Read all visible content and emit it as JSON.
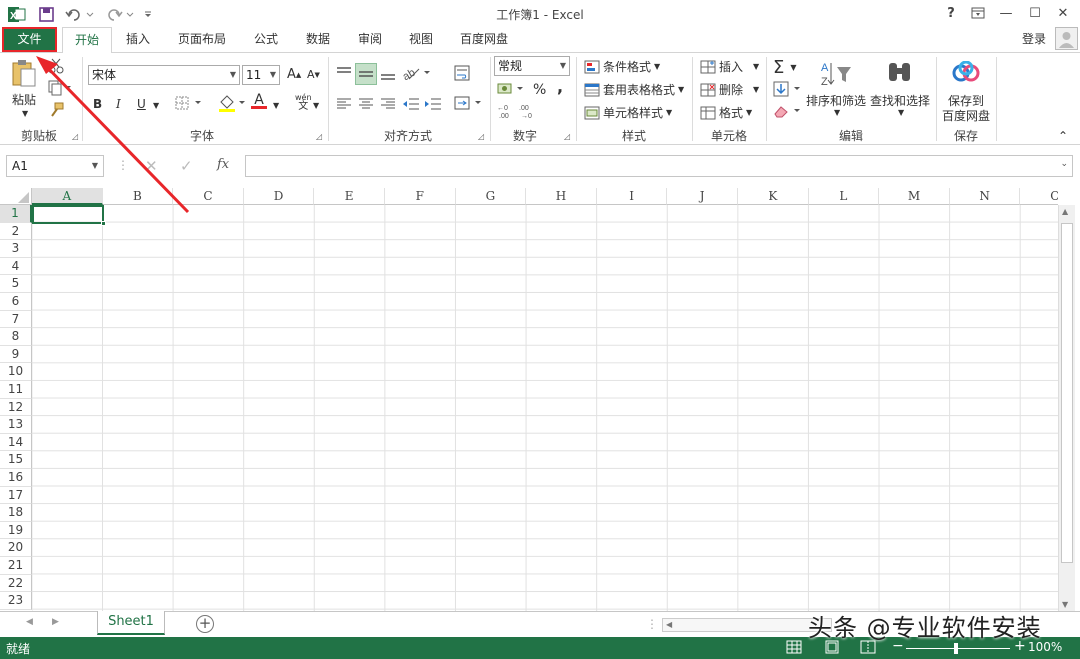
{
  "titlebar": {
    "title": "工作簿1 - Excel",
    "help": "?",
    "minimize": "—",
    "maximize": "☐",
    "close": "✕"
  },
  "tabs": [
    "文件",
    "开始",
    "插入",
    "页面布局",
    "公式",
    "数据",
    "审阅",
    "视图",
    "百度网盘"
  ],
  "account": {
    "login": "登录"
  },
  "ribbon": {
    "clipboard": {
      "paste": "粘贴",
      "label": "剪贴板"
    },
    "font": {
      "name": "宋体",
      "size": "11",
      "label": "字体",
      "bold": "B",
      "italic": "I",
      "underline": "U",
      "grow": "A",
      "shrink": "A",
      "font_color": "A",
      "wen": "wén"
    },
    "alignment": {
      "label": "对齐方式"
    },
    "number": {
      "format": "常规",
      "label": "数字",
      "percent": "%",
      "comma": ","
    },
    "styles": {
      "conditional": "条件格式",
      "table": "套用表格格式",
      "cell_styles": "单元格样式",
      "label": "样式"
    },
    "cells": {
      "insert": "插入",
      "delete": "删除",
      "format": "格式",
      "label": "单元格"
    },
    "editing": {
      "sort": "排序和筛选",
      "find": "查找和选择",
      "label": "编辑"
    },
    "save": {
      "line1": "保存到",
      "line2": "百度网盘",
      "label": "保存"
    }
  },
  "formula_bar": {
    "name_box": "A1",
    "fx": "fx",
    "formula": ""
  },
  "columns": [
    "A",
    "B",
    "C",
    "D",
    "E",
    "F",
    "G",
    "H",
    "I",
    "J",
    "K",
    "L",
    "M",
    "N",
    "O"
  ],
  "rows": [
    "1",
    "2",
    "3",
    "4",
    "5",
    "6",
    "7",
    "8",
    "9",
    "10",
    "11",
    "12",
    "13",
    "14",
    "15",
    "16",
    "17",
    "18",
    "19",
    "20",
    "21",
    "22",
    "23"
  ],
  "sheets": {
    "active": "Sheet1",
    "add": "+"
  },
  "status": {
    "ready": "就绪",
    "zoom": "100%",
    "zoom_minus": "−",
    "zoom_plus": "+"
  },
  "watermark": "头条 @专业软件安装",
  "colors": {
    "accent": "#217346",
    "highlight": "#e8262a"
  }
}
